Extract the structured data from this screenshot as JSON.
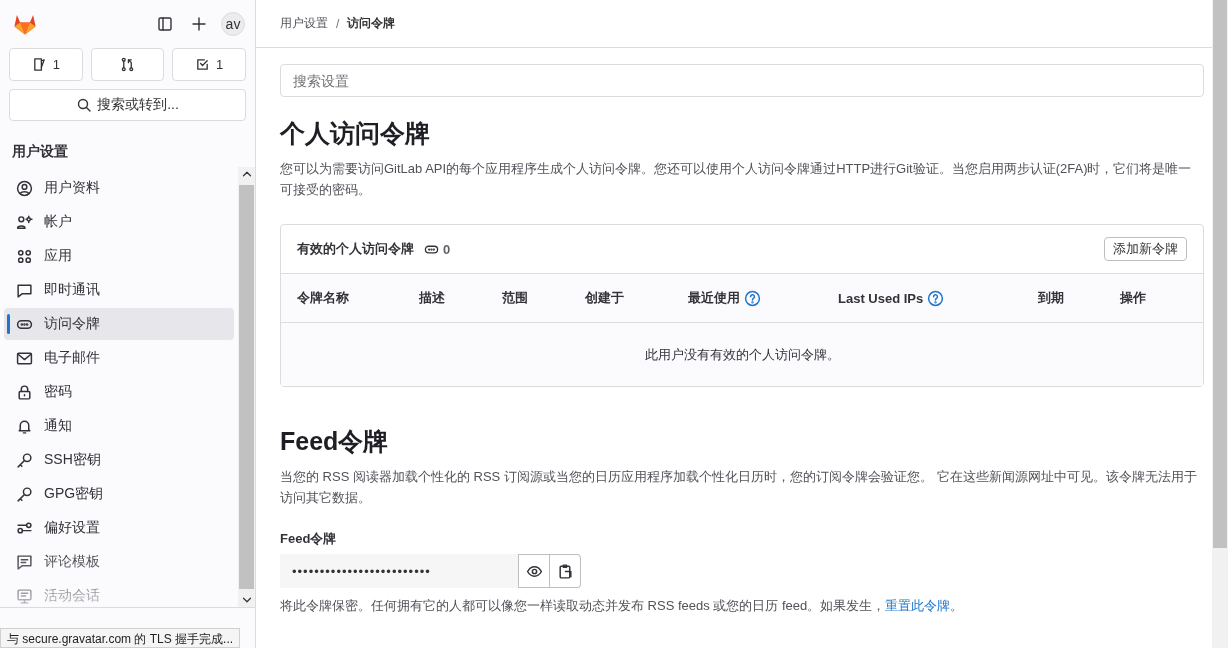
{
  "sidebar": {
    "avatar": "av",
    "counters": [
      {
        "kind": "issues",
        "count": "1"
      },
      {
        "kind": "merge"
      },
      {
        "kind": "todos",
        "count": "1"
      }
    ],
    "search": "搜索或转到...",
    "section_title": "用户设置",
    "items": [
      {
        "label": "用户资料",
        "selected": false
      },
      {
        "label": "帐户",
        "selected": false
      },
      {
        "label": "应用",
        "selected": false
      },
      {
        "label": "即时通讯",
        "selected": false
      },
      {
        "label": "访问令牌",
        "selected": true
      },
      {
        "label": "电子邮件",
        "selected": false
      },
      {
        "label": "密码",
        "selected": false
      },
      {
        "label": "通知",
        "selected": false
      },
      {
        "label": "SSH密钥",
        "selected": false
      },
      {
        "label": "GPG密钥",
        "selected": false
      },
      {
        "label": "偏好设置",
        "selected": false
      },
      {
        "label": "评论模板",
        "selected": false
      },
      {
        "label": "活动会话",
        "selected": false
      }
    ]
  },
  "breadcrumb": [
    "用户设置",
    "访问令牌"
  ],
  "breadcrumb_separator": "/",
  "search": {
    "placeholder": "搜索设置"
  },
  "pat": {
    "title": "个人访问令牌",
    "description": "您可以为需要访问GitLab API的每个应用程序生成个人访问令牌。您还可以使用个人访问令牌通过HTTP进行Git验证。当您启用两步认证(2FA)时，它们将是唯一可接受的密码。",
    "card_title": "有效的个人访问令牌",
    "count": "0",
    "add_button": "添加新令牌",
    "columns": [
      {
        "label": "令牌名称",
        "help": false
      },
      {
        "label": "描述",
        "help": false
      },
      {
        "label": "范围",
        "help": false
      },
      {
        "label": "创建于",
        "help": false
      },
      {
        "label": "最近使用",
        "help": true
      },
      {
        "label": "Last Used IPs",
        "help": true
      },
      {
        "label": "到期",
        "help": false
      },
      {
        "label": "操作",
        "help": false
      }
    ],
    "empty": "此用户没有有效的个人访问令牌。"
  },
  "feed": {
    "title": "Feed令牌",
    "description": "当您的 RSS 阅读器加载个性化的 RSS 订阅源或当您的日历应用程序加载个性化日历时，您的订阅令牌会验证您。 它在这些新闻源网址中可见。该令牌无法用于访问其它数据。",
    "label": "Feed令牌",
    "value": "•••••••••••••••••••••••••",
    "note": "将此令牌保密。任何拥有它的人都可以像您一样读取动态并发布 RSS feeds 或您的日历 feed。如果发生，",
    "link": "重置此令牌",
    "note_end": "。"
  },
  "status_bar": "与 secure.gravatar.com 的 TLS 握手完成..."
}
